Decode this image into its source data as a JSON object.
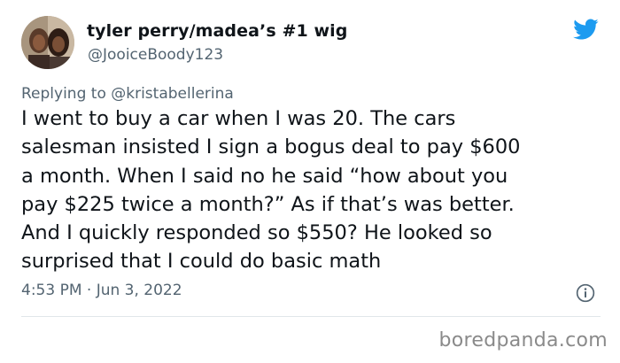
{
  "user": {
    "display_name": "tyler perry/madea’s #1 wig",
    "handle": "@JooiceBoody123"
  },
  "reply": {
    "prefix": "Replying to ",
    "mention": "@kristabellerina"
  },
  "tweet": {
    "text": "I went to buy a car when I was 20. The cars\nsalesman insisted I sign a bogus deal to pay $600\na month. When I said no he said “how about you\npay $225 twice a month?” As if that’s was better.\nAnd I quickly responded so $550? He looked so\nsurprised that I could do basic math",
    "timestamp": "4:53 PM · Jun 3, 2022"
  },
  "icons": {
    "brand": "twitter-bird-icon",
    "info": "info-icon"
  },
  "colors": {
    "brand_blue": "#1d9bf0",
    "secondary_text": "#536471"
  },
  "watermark": "boredpanda.com"
}
